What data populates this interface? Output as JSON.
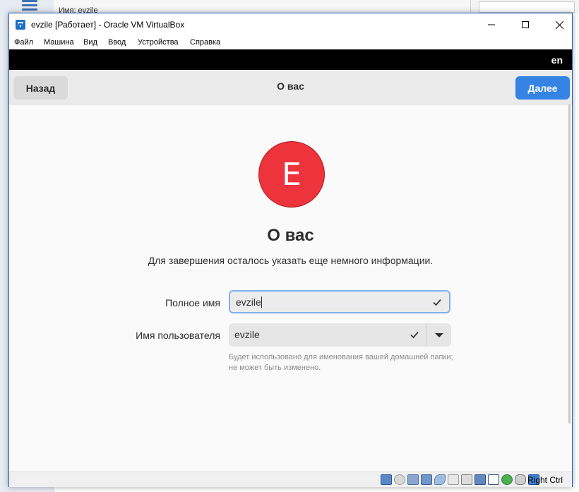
{
  "background": {
    "strip_text": "Имя:    evzile"
  },
  "window": {
    "title": "evzile [Работает] - Oracle VM VirtualBox",
    "controls": {
      "minimize": "—",
      "maximize": "☐",
      "close": "✕"
    }
  },
  "menu": {
    "items": [
      {
        "label": "Файл"
      },
      {
        "label": "Машина"
      },
      {
        "label": "Вид"
      },
      {
        "label": "Ввод"
      },
      {
        "label": "Устройства"
      },
      {
        "label": "Справка"
      }
    ]
  },
  "guest": {
    "topbar": {
      "language": "en"
    },
    "header": {
      "back_label": "Назад",
      "title": "О вас",
      "next_label": "Далее"
    },
    "avatar_letter": "E",
    "heading": "О вас",
    "subtitle": "Для завершения осталось указать еще немного информации.",
    "fullname": {
      "label": "Полное имя",
      "value": "evzile"
    },
    "username": {
      "label": "Имя пользователя",
      "value": "evzile",
      "hint": "Будет использовано для именования вашей домашней папки; не может быть изменено."
    }
  },
  "status_bar": {
    "host_key": "Right Ctrl",
    "icons": [
      "hard-disk-icon",
      "optical-drive-icon",
      "audio-icon",
      "network-icon",
      "usb-icon",
      "shared-folders-icon",
      "display-icon",
      "video-capture-icon",
      "virtualization-icon",
      "guest-additions-icon",
      "mouse-integration-icon",
      "keyboard-capture-icon"
    ]
  },
  "colors": {
    "accent": "#3584e4",
    "avatar": "#ed333b",
    "title_border": "#1e5eb8"
  }
}
